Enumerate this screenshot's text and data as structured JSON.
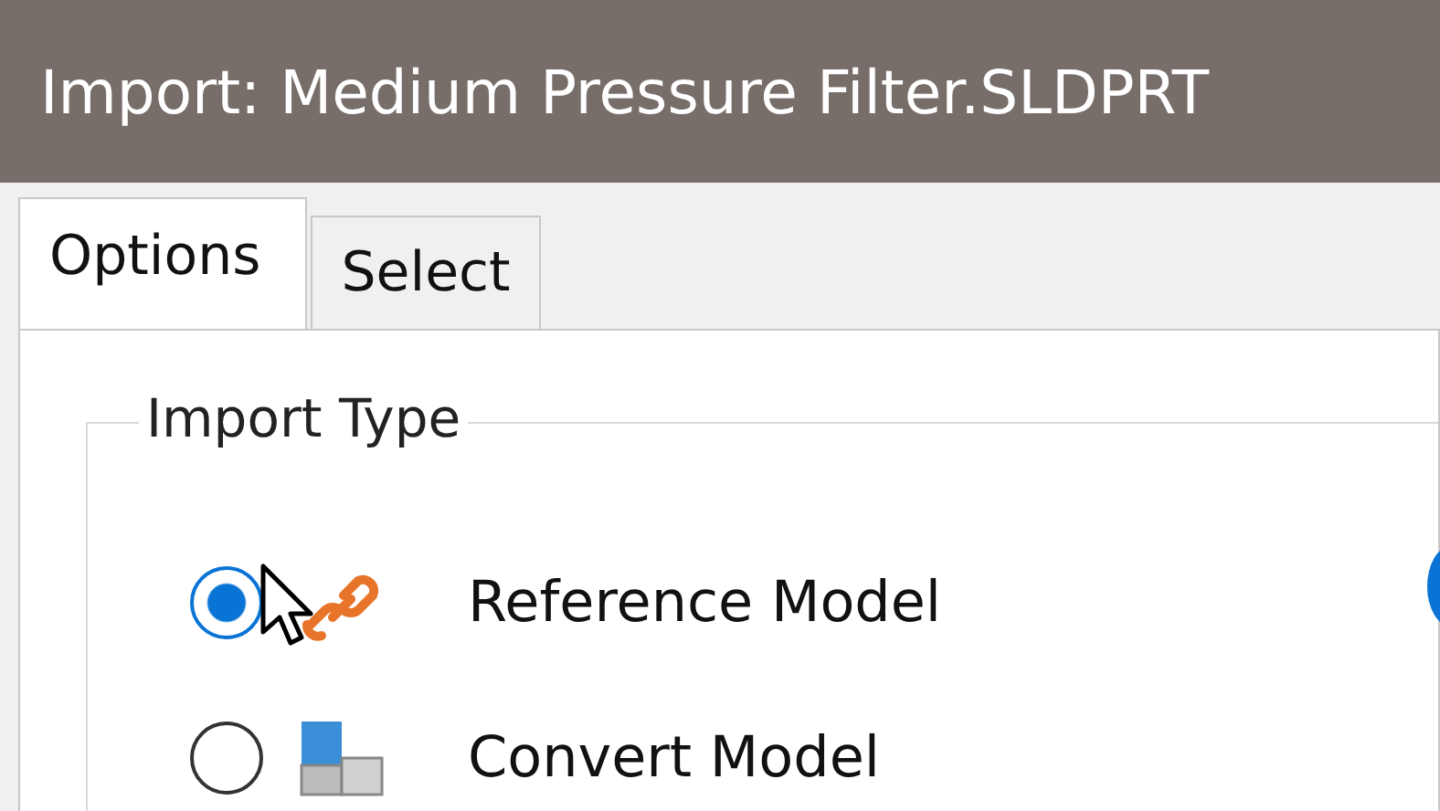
{
  "window": {
    "title": "Import:  Medium Pressure Filter.SLDPRT"
  },
  "tabs": [
    {
      "label": "Options",
      "selected": true
    },
    {
      "label": "Select",
      "selected": false
    }
  ],
  "import_type": {
    "title": "Import Type",
    "options": [
      {
        "label": "Reference Model",
        "selected": true,
        "kind": "reference"
      },
      {
        "label": "Convert Model",
        "selected": false,
        "kind": "convert"
      }
    ]
  }
}
